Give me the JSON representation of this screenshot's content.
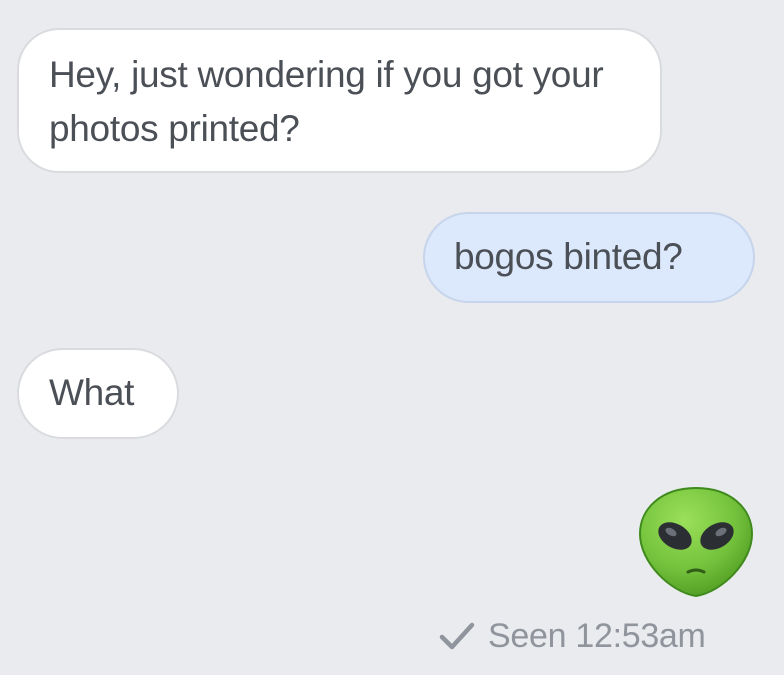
{
  "messages": [
    {
      "direction": "incoming",
      "text": "Hey, just wondering if you got your photos printed?"
    },
    {
      "direction": "outgoing",
      "text": "bogos binted?"
    },
    {
      "direction": "incoming",
      "text": "What"
    },
    {
      "direction": "outgoing",
      "emoji": "alien-emoji"
    }
  ],
  "receipt": {
    "icon": "checkmark-icon",
    "text": "Seen 12:53am"
  },
  "colors": {
    "background": "#e9ebee",
    "incoming_bubble": "#ffffff",
    "outgoing_bubble": "#dce8fb",
    "text": "#4b4f56",
    "receipt_text": "#90949c",
    "alien_green": "#7ac943"
  }
}
